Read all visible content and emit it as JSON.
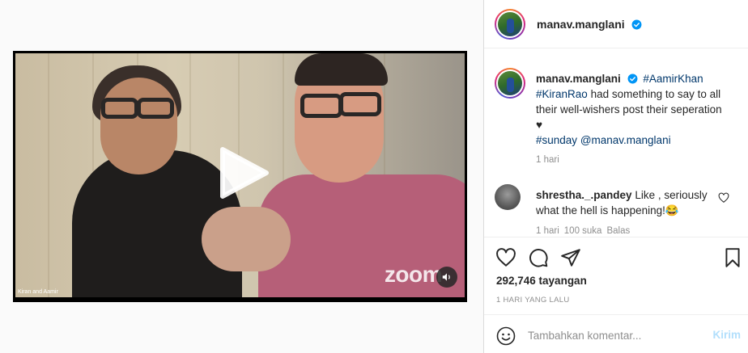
{
  "post": {
    "username": "manav.manglani",
    "video": {
      "caption_overlay": "Kiran and Aamir",
      "watermark": "zoom"
    },
    "caption": {
      "username": "manav.manglani",
      "tag1": "#AamirKhan",
      "tag2": "#KiranRao",
      "text": "had something to say to all their well-wishers post their seperation",
      "heart": "♥",
      "tag3": "#sunday",
      "mention": "@manav.manglani",
      "time": "1 hari"
    },
    "comment": {
      "username": "shrestha._.pandey",
      "text": "Like , seriously what the hell is happening!😂",
      "time": "1 hari",
      "likes": "100 suka",
      "reply": "Balas"
    },
    "views": "292,746 tayangan",
    "posted": "1 HARI YANG LALU",
    "add_comment": {
      "placeholder": "Tambahkan komentar...",
      "post_label": "Kirim"
    }
  },
  "colors": {
    "link": "#00376b",
    "verified": "#0095f6",
    "muted": "#8e8e8e",
    "post_disabled": "#b2dffc"
  },
  "icons": [
    "play-icon",
    "mute-icon",
    "verified-icon",
    "heart-icon",
    "comment-icon",
    "share-icon",
    "bookmark-icon",
    "emoji-icon"
  ]
}
